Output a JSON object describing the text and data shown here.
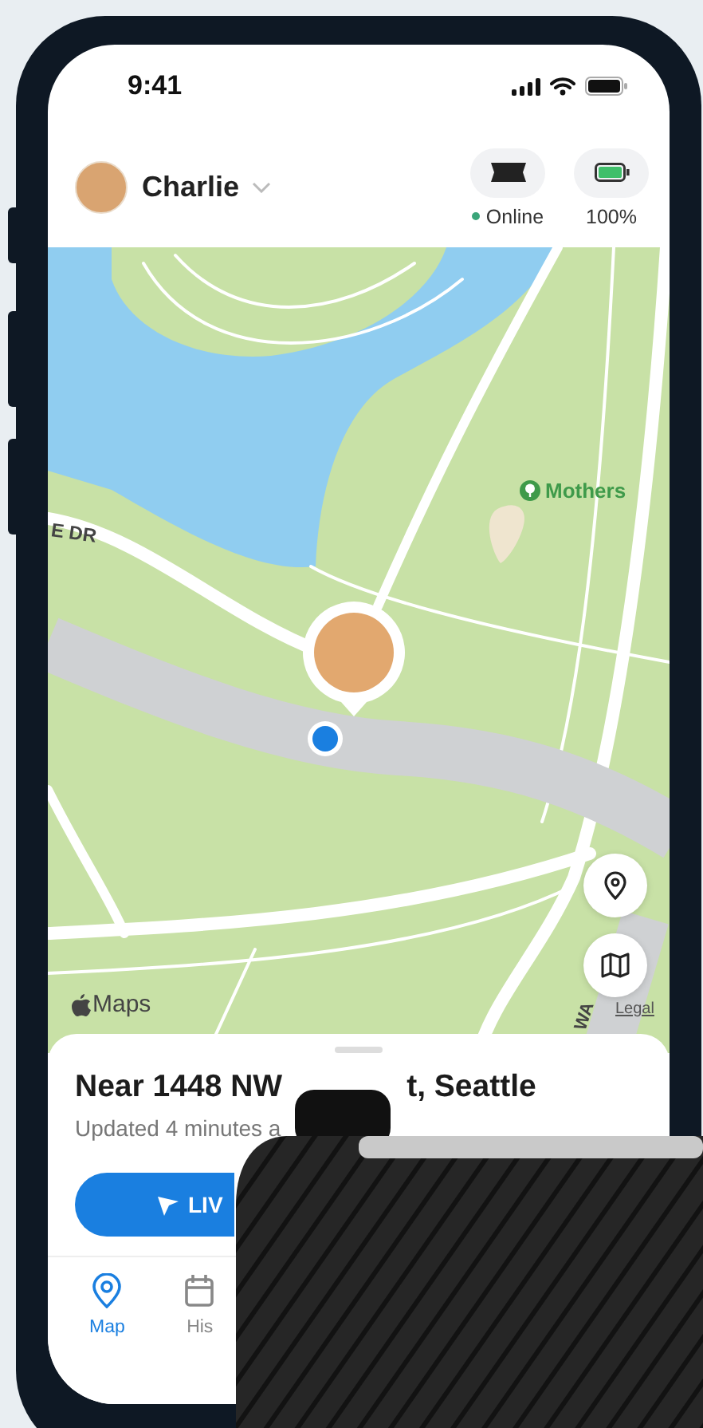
{
  "status_bar": {
    "time": "9:41"
  },
  "header": {
    "pet_name": "Charlie",
    "device": {
      "status": "Online",
      "online": true
    },
    "battery": {
      "reading": "100%"
    }
  },
  "map": {
    "labels": [
      {
        "kind": "road",
        "text": "E DR"
      },
      {
        "kind": "place",
        "text": "Mothers"
      },
      {
        "kind": "road",
        "text": "WA"
      }
    ],
    "attribution": "Maps",
    "legal": "Legal"
  },
  "location": {
    "address_parts": [
      "Near 1448 NW",
      "t, Seattle"
    ],
    "updated": "Updated 4 minutes a",
    "button": "LIV"
  },
  "tabs": [
    {
      "label": "Map",
      "selected": true
    },
    {
      "label": "His",
      "selected": false
    }
  ]
}
